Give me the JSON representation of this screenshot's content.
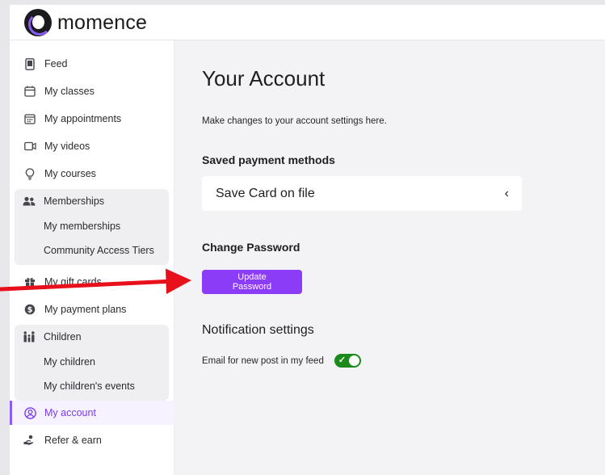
{
  "brand": {
    "name": "momence",
    "accent": "#8b3cf7"
  },
  "sidebar": {
    "items": [
      {
        "label": "Feed",
        "icon": "phone-icon"
      },
      {
        "label": "My classes",
        "icon": "calendar-icon"
      },
      {
        "label": "My appointments",
        "icon": "calendar-grid-icon"
      },
      {
        "label": "My videos",
        "icon": "video-icon"
      },
      {
        "label": "My courses",
        "icon": "lightbulb-icon"
      }
    ],
    "memberships": {
      "label": "Memberships",
      "icon": "users-icon",
      "children": [
        "My memberships",
        "Community Access Tiers"
      ]
    },
    "middle": [
      {
        "label": "My gift cards",
        "icon": "gift-icon"
      },
      {
        "label": "My payment plans",
        "icon": "dollar-icon"
      }
    ],
    "children_group": {
      "label": "Children",
      "icon": "family-icon",
      "children": [
        "My children",
        "My children's events"
      ]
    },
    "bottom": [
      {
        "label": "My account",
        "icon": "user-circle-icon",
        "active": true
      },
      {
        "label": "Refer & earn",
        "icon": "hand-coin-icon"
      }
    ]
  },
  "main": {
    "title": "Your Account",
    "subtitle": "Make changes to your account settings here.",
    "payment": {
      "heading": "Saved payment methods",
      "card_label": "Save Card on file",
      "chevron": "‹"
    },
    "password": {
      "heading": "Change Password",
      "button_line1": "Update",
      "button_line2": "Password"
    },
    "notifications": {
      "heading": "Notification settings",
      "toggle_label": "Email for new post in my feed",
      "toggle_on": true
    }
  },
  "colors": {
    "toggle_on": "#1a8a1a",
    "annotation_arrow": "#e8101a"
  }
}
